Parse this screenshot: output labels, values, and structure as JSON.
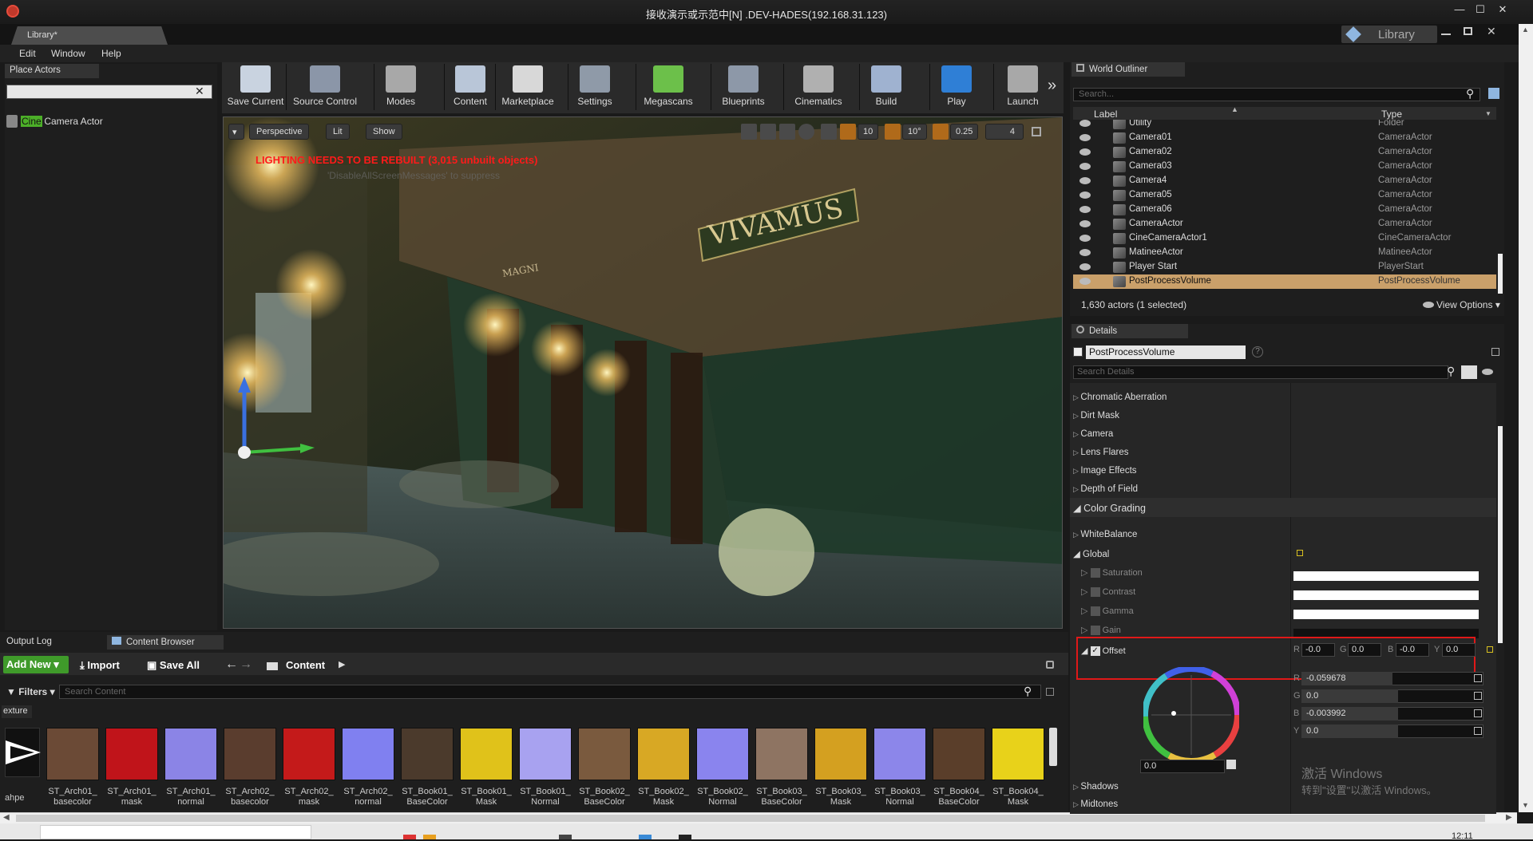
{
  "window": {
    "title": "接收演示或示范中[N] .DEV-HADES(192.168.31.123)",
    "controls": [
      "—",
      "☐",
      "✕"
    ]
  },
  "doc_tab": {
    "label": "Library*"
  },
  "library_badge": "Library",
  "menu": [
    "Edit",
    "Window",
    "Help"
  ],
  "place_actors": {
    "tab": "Place Actors",
    "search_value": "",
    "result_highlight": "Cine",
    "result_rest": " Camera Actor"
  },
  "toolbar": [
    {
      "label": "Save Current",
      "color": "#c9d3e0"
    },
    {
      "label": "Source Control",
      "color": "#8b96a8"
    },
    {
      "label": "Modes",
      "color": "#a8a8a8"
    },
    {
      "label": "Content",
      "color": "#b9c6d8"
    },
    {
      "label": "Marketplace",
      "color": "#d8d8d8"
    },
    {
      "label": "Settings",
      "color": "#8f9aa8"
    },
    {
      "label": "Megascans",
      "color": "#6cc04a"
    },
    {
      "label": "Blueprints",
      "color": "#8d98a8"
    },
    {
      "label": "Cinematics",
      "color": "#b0b0b0"
    },
    {
      "label": "Build",
      "color": "#9fb2d0"
    },
    {
      "label": "Play",
      "color": "#2f7fd6"
    },
    {
      "label": "Launch",
      "color": "#a8a8a8"
    }
  ],
  "viewport": {
    "perspective": "Perspective",
    "lit": "Lit",
    "show": "Show",
    "warning": "LIGHTING NEEDS TO BE REBUILT (3,015 unbuilt objects)",
    "warning_sub": "'DisableAllScreenMessages' to suppress",
    "grid_value": "10",
    "angle_value": "10°",
    "scale_value": "0.25",
    "camera_speed": "4",
    "sign_text": "VIVAMUS",
    "plaque_text": "MAGNI"
  },
  "world_outliner": {
    "tab": "World Outliner",
    "search_placeholder": "Search...",
    "col_label": "Label",
    "col_type": "Type",
    "rows": [
      {
        "label": "Utility",
        "type": "Folder"
      },
      {
        "label": "Camera01",
        "type": "CameraActor"
      },
      {
        "label": "Camera02",
        "type": "CameraActor"
      },
      {
        "label": "Camera03",
        "type": "CameraActor"
      },
      {
        "label": "Camera4",
        "type": "CameraActor"
      },
      {
        "label": "Camera05",
        "type": "CameraActor"
      },
      {
        "label": "Camera06",
        "type": "CameraActor"
      },
      {
        "label": "CameraActor",
        "type": "CameraActor"
      },
      {
        "label": "CineCameraActor1",
        "type": "CineCameraActor"
      },
      {
        "label": "MatineeActor",
        "type": "MatineeActor"
      },
      {
        "label": "Player Start",
        "type": "PlayerStart"
      },
      {
        "label": "PostProcessVolume",
        "type": "PostProcessVolume"
      }
    ],
    "selected_row": 11,
    "status": "1,630 actors (1 selected)",
    "view_options": "View Options"
  },
  "details": {
    "tab": "Details",
    "name_value": "PostProcessVolume",
    "search_placeholder": "Search Details",
    "categories": [
      "Chromatic Aberration",
      "Dirt Mask",
      "Camera",
      "Lens Flares",
      "Image Effects",
      "Depth of Field"
    ],
    "color_grading": "Color Grading",
    "white_balance": "WhiteBalance",
    "global": "Global",
    "global_subs": [
      "Saturation",
      "Contrast",
      "Gamma",
      "Gain"
    ],
    "offset": {
      "label": "Offset",
      "checked": true,
      "r_short": "-0.0",
      "g_short": "0.0",
      "b_short": "-0.0",
      "y_short": "0.0",
      "r": "-0.059678",
      "g": "0.0",
      "b": "-0.003992",
      "y": "0.0",
      "wheel_value": "0.0",
      "r_fill": 0.5,
      "g_fill": 0.53,
      "b_fill": 0.53,
      "y_fill": 0.53
    },
    "channel_labels": {
      "r": "R",
      "g": "G",
      "b": "B",
      "y": "Y"
    },
    "bottom_cats": [
      "Shadows",
      "Midtones"
    ]
  },
  "watermark": {
    "line1": "激活 Windows",
    "line2": "转到\"设置\"以激活 Windows。"
  },
  "bottom_tabs": {
    "output_log": "Output Log",
    "content_browser": "Content Browser"
  },
  "content_browser": {
    "add_new": "Add New",
    "import": "Import",
    "save_all": "Save All",
    "path": "Content",
    "filters": "Filters",
    "search_placeholder": "Search Content",
    "left_filter": "exture",
    "left_thumb_label": "ahpe",
    "assets": [
      {
        "line1": "ST_Arch01_",
        "line2": "basecolor",
        "color": "#6b4a36"
      },
      {
        "line1": "ST_Arch01_",
        "line2": "mask",
        "color": "#c0141a"
      },
      {
        "line1": "ST_Arch01_",
        "line2": "normal",
        "color": "#8b84e6"
      },
      {
        "line1": "ST_Arch02_",
        "line2": "basecolor",
        "color": "#5a3d2e"
      },
      {
        "line1": "ST_Arch02_",
        "line2": "mask",
        "color": "#c41a1a"
      },
      {
        "line1": "ST_Arch02_",
        "line2": "normal",
        "color": "#8080f0"
      },
      {
        "line1": "ST_Book01_",
        "line2": "BaseColor",
        "color": "#4b3a2c"
      },
      {
        "line1": "ST_Book01_",
        "line2": "Mask",
        "color": "#e0c21a"
      },
      {
        "line1": "ST_Book01_",
        "line2": "Normal",
        "color": "#a8a2f0"
      },
      {
        "line1": "ST_Book02_",
        "line2": "BaseColor",
        "color": "#7a5a3e"
      },
      {
        "line1": "ST_Book02_",
        "line2": "Mask",
        "color": "#d8a824"
      },
      {
        "line1": "ST_Book02_",
        "line2": "Normal",
        "color": "#8a84ee"
      },
      {
        "line1": "ST_Book03_",
        "line2": "BaseColor",
        "color": "#8e7462"
      },
      {
        "line1": "ST_Book03_",
        "line2": "Mask",
        "color": "#d4a020"
      },
      {
        "line1": "ST_Book03_",
        "line2": "Normal",
        "color": "#8c86ea"
      },
      {
        "line1": "ST_Book04_",
        "line2": "BaseColor",
        "color": "#5a3e2a"
      },
      {
        "line1": "ST_Book04_",
        "line2": "Mask",
        "color": "#e8d21a"
      }
    ]
  },
  "taskbar": {
    "clock": "12:11"
  }
}
